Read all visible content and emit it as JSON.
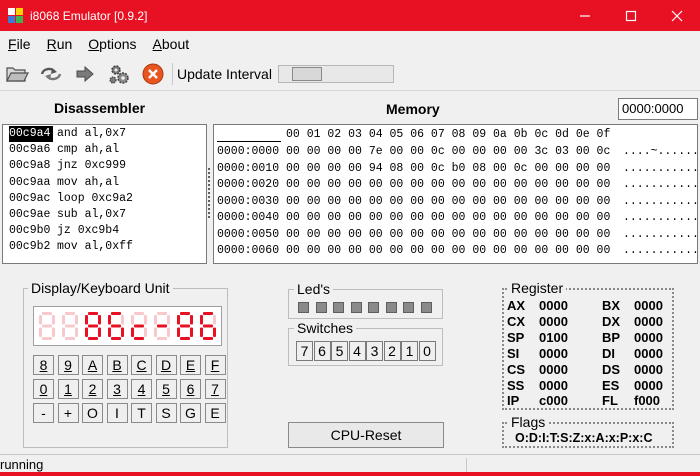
{
  "window": {
    "title": "i8068 Emulator [0.9.2]"
  },
  "menu": [
    {
      "label": "File",
      "accel": "F",
      "rest": "ile"
    },
    {
      "label": "Run",
      "accel": "R",
      "rest": "un"
    },
    {
      "label": "Options",
      "accel": "O",
      "rest": "ptions"
    },
    {
      "label": "About",
      "accel": "A",
      "rest": "bout"
    }
  ],
  "toolbar": {
    "update_interval_label": "Update Interval",
    "update_interval_value": 0.15,
    "icons": [
      "open-folder-icon",
      "reload-icon",
      "run-arrow-icon",
      "step-gears-icon",
      "stop-icon"
    ]
  },
  "disassembler": {
    "title": "Disassembler",
    "rows": [
      {
        "addr": "00c9a4",
        "ins": "and al,0x7",
        "selected": true
      },
      {
        "addr": "00c9a6",
        "ins": "cmp ah,al"
      },
      {
        "addr": "00c9a8",
        "ins": "jnz 0xc999"
      },
      {
        "addr": "00c9aa",
        "ins": "mov ah,al"
      },
      {
        "addr": "00c9ac",
        "ins": "loop 0xc9a2"
      },
      {
        "addr": "00c9ae",
        "ins": "sub al,0x7"
      },
      {
        "addr": "00c9b0",
        "ins": "jz 0xc9b4"
      },
      {
        "addr": "00c9b2",
        "ins": "mov al,0xff"
      }
    ]
  },
  "memory": {
    "title": "Memory",
    "address_input": "0000:0000",
    "columns": "00 01 02 03 04 05 06 07 08 09 0a 0b 0c 0d 0e 0f",
    "rows": [
      {
        "addr": "0000:0000",
        "bytes": "00 00 00 00 7e 00 00 0c 00 00 00 00 3c 03 00 0c",
        "ascii": "....~......<...."
      },
      {
        "addr": "0000:0010",
        "bytes": "00 00 00 00 94 08 00 0c b0 08 00 0c 00 00 00 00",
        "ascii": "................"
      },
      {
        "addr": "0000:0020",
        "bytes": "00 00 00 00 00 00 00 00 00 00 00 00 00 00 00 00",
        "ascii": "................"
      },
      {
        "addr": "0000:0030",
        "bytes": "00 00 00 00 00 00 00 00 00 00 00 00 00 00 00 00",
        "ascii": "................"
      },
      {
        "addr": "0000:0040",
        "bytes": "00 00 00 00 00 00 00 00 00 00 00 00 00 00 00 00",
        "ascii": "................"
      },
      {
        "addr": "0000:0050",
        "bytes": "00 00 00 00 00 00 00 00 00 00 00 00 00 00 00 00",
        "ascii": "................"
      },
      {
        "addr": "0000:0060",
        "bytes": "00 00 00 00 00 00 00 00 00 00 00 00 00 00 00 00",
        "ascii": "................"
      }
    ]
  },
  "display_unit": {
    "title": "Display/Keyboard Unit",
    "segment_text": "86c-86",
    "segment_active_color": "#e81123",
    "segment_off_color": "#f7c9cd",
    "keys": [
      {
        "label": "8",
        "ul": true
      },
      {
        "label": "9",
        "ul": true
      },
      {
        "label": "A",
        "ul": true
      },
      {
        "label": "B",
        "ul": true
      },
      {
        "label": "C",
        "ul": true
      },
      {
        "label": "D",
        "ul": true
      },
      {
        "label": "E",
        "ul": true
      },
      {
        "label": "F",
        "ul": true
      },
      {
        "label": "0",
        "ul": true
      },
      {
        "label": "1",
        "ul": true
      },
      {
        "label": "2",
        "ul": true
      },
      {
        "label": "3",
        "ul": true
      },
      {
        "label": "4",
        "ul": true
      },
      {
        "label": "5",
        "ul": true
      },
      {
        "label": "6",
        "ul": true
      },
      {
        "label": "7",
        "ul": true
      },
      {
        "label": "-",
        "ul": false
      },
      {
        "label": "+",
        "ul": false
      },
      {
        "label": "O",
        "ul": false
      },
      {
        "label": "I",
        "ul": false
      },
      {
        "label": "T",
        "ul": false
      },
      {
        "label": "S",
        "ul": false
      },
      {
        "label": "G",
        "ul": false
      },
      {
        "label": "E",
        "ul": false
      }
    ]
  },
  "leds": {
    "title": "Led's",
    "count": 8
  },
  "switches": {
    "title": "Switches",
    "labels": [
      "7",
      "6",
      "5",
      "4",
      "3",
      "2",
      "1",
      "0"
    ]
  },
  "cpu_reset": {
    "label": "CPU-Reset"
  },
  "registers": {
    "title": "Register",
    "items": [
      {
        "name": "AX",
        "value": "0000"
      },
      {
        "name": "BX",
        "value": "0000"
      },
      {
        "name": "CX",
        "value": "0000"
      },
      {
        "name": "DX",
        "value": "0000"
      },
      {
        "name": "SP",
        "value": "0100"
      },
      {
        "name": "BP",
        "value": "0000"
      },
      {
        "name": "SI",
        "value": "0000"
      },
      {
        "name": "DI",
        "value": "0000"
      },
      {
        "name": "CS",
        "value": "0000"
      },
      {
        "name": "DS",
        "value": "0000"
      },
      {
        "name": "SS",
        "value": "0000"
      },
      {
        "name": "ES",
        "value": "0000"
      },
      {
        "name": "IP",
        "value": "c000"
      },
      {
        "name": "FL",
        "value": "f000"
      }
    ]
  },
  "flags": {
    "title": "Flags",
    "value": "O:D:I:T:S:Z:x:A:x:P:x:C"
  },
  "status": {
    "text": "running"
  }
}
